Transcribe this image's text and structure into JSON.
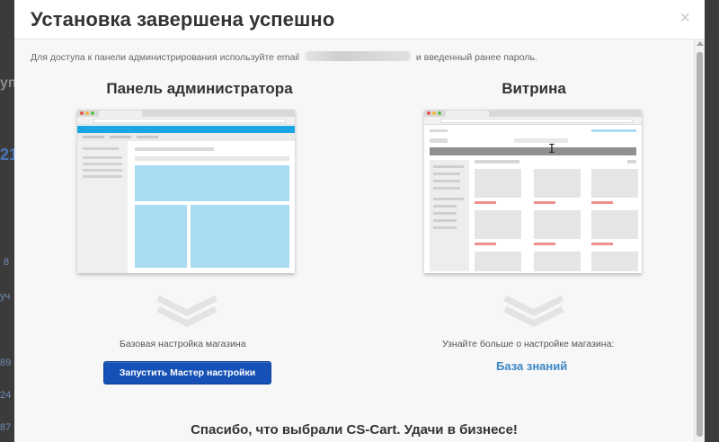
{
  "modal": {
    "title": "Установка завершена успешно",
    "close_symbol": "×",
    "notice_before": "Для доступа к панели администрирования используйте email",
    "notice_after": "и введенный ранее пароль."
  },
  "admin": {
    "title": "Панель администратора",
    "caption": "Базовая настройка магазина",
    "button_label": "Запустить Мастер настройки"
  },
  "storefront": {
    "title": "Витрина",
    "caption": "Узнайте больше о настройке магазина:",
    "link_label": "База знаний"
  },
  "footer": {
    "thanks": "Спасибо, что выбрали CS-Cart. Удачи в бизнесе!"
  },
  "background": {
    "fragments": [
      "уп",
      "21",
      "8",
      "уч",
      "89",
      "24",
      "87"
    ]
  },
  "colors": {
    "accent_button": "#1551b6",
    "link": "#3b86c6",
    "admin_blue": "#a9dbf2",
    "admin_header": "#1aa5e3"
  },
  "icons": {
    "close": "close-icon",
    "chevron": "double-chevron-down-icon",
    "cursor": "text-cursor-icon"
  }
}
